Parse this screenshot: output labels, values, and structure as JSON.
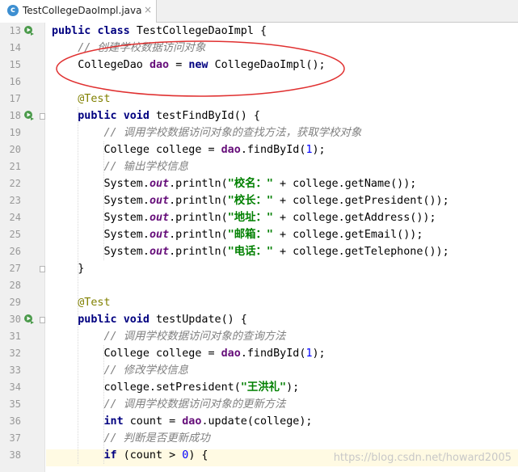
{
  "tab": {
    "title": "TestCollegeDaoImpl.java",
    "icon": "java-class-icon",
    "close": "×",
    "file_badge": "c"
  },
  "gutter": {
    "line_numbers": [
      "13",
      "14",
      "15",
      "16",
      "17",
      "18",
      "19",
      "20",
      "21",
      "22",
      "23",
      "24",
      "25",
      "26",
      "27",
      "28",
      "29",
      "30",
      "31",
      "32",
      "33",
      "34",
      "35",
      "36",
      "37",
      "38"
    ]
  },
  "code": {
    "l13": {
      "kw1": "public",
      "kw2": "class",
      "name": "TestCollegeDaoImpl",
      "brace": "{"
    },
    "l14": {
      "comment": "// 创建学校数据访问对象"
    },
    "l15": {
      "type": "CollegeDao",
      "var": "dao",
      "eq": "=",
      "kw": "new",
      "ctor": "CollegeDaoImpl();"
    },
    "l17": {
      "annotation": "@Test"
    },
    "l18": {
      "kw1": "public",
      "kw2": "void",
      "sig": "testFindById() {"
    },
    "l19": {
      "comment": "// 调用学校数据访问对象的查找方法，获取学校对象"
    },
    "l20": {
      "a": "College college = ",
      "dao": "dao",
      "b": ".findById(",
      "num": "1",
      "c": ");"
    },
    "l21": {
      "comment": "// 输出学校信息"
    },
    "l22": {
      "sys": "System.",
      "out": "out",
      "mid": ".println(",
      "str": "\"校名：\"",
      "rest": " + college.getName());"
    },
    "l23": {
      "sys": "System.",
      "out": "out",
      "mid": ".println(",
      "str": "\"校长：\"",
      "rest": " + college.getPresident());"
    },
    "l24": {
      "sys": "System.",
      "out": "out",
      "mid": ".println(",
      "str": "\"地址：\"",
      "rest": " + college.getAddress());"
    },
    "l25": {
      "sys": "System.",
      "out": "out",
      "mid": ".println(",
      "str": "\"邮箱：\"",
      "rest": " + college.getEmail());"
    },
    "l26": {
      "sys": "System.",
      "out": "out",
      "mid": ".println(",
      "str": "\"电话：\"",
      "rest": " + college.getTelephone());"
    },
    "l27": {
      "brace": "}"
    },
    "l29": {
      "annotation": "@Test"
    },
    "l30": {
      "kw1": "public",
      "kw2": "void",
      "sig": "testUpdate() {"
    },
    "l31": {
      "comment": "// 调用学校数据访问对象的查询方法"
    },
    "l32": {
      "a": "College college = ",
      "dao": "dao",
      "b": ".findById(",
      "num": "1",
      "c": ");"
    },
    "l33": {
      "comment": "// 修改学校信息"
    },
    "l34": {
      "a": "college.setPresident(",
      "str": "\"王洪礼\"",
      "c": ");"
    },
    "l35": {
      "comment": "// 调用学校数据访问对象的更新方法"
    },
    "l36": {
      "kw": "int",
      "a": " count = ",
      "dao": "dao",
      "b": ".update(college);"
    },
    "l37": {
      "comment": "// 判断是否更新成功"
    },
    "l38": {
      "kw": "if",
      "a": " (count > ",
      "num": "0",
      "b": ") {"
    }
  },
  "watermark": "https://blog.csdn.net/howard2005",
  "colors": {
    "keyword": "#000080",
    "field": "#660e7a",
    "comment": "#808080",
    "annotation": "#808000",
    "string": "#008000",
    "number": "#0000ff",
    "run_icon": "#4a9a4a",
    "ellipse": "#e03030"
  }
}
